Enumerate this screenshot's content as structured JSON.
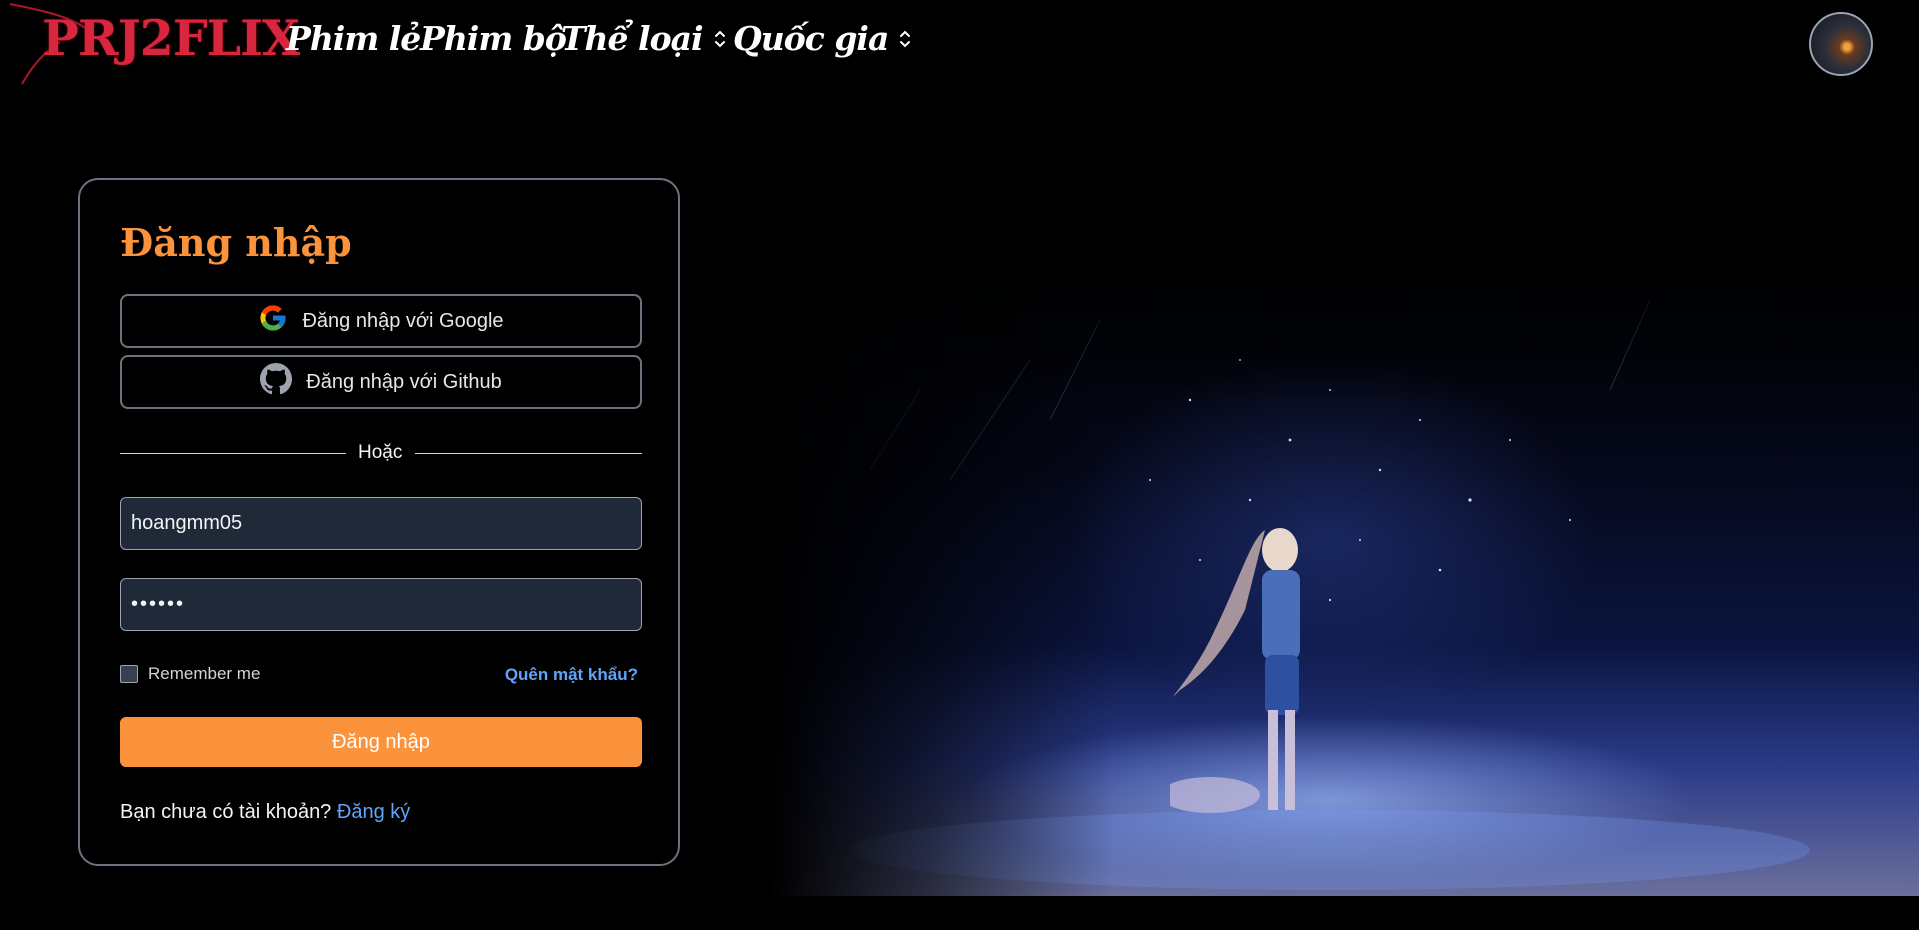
{
  "header": {
    "logo_text": "PRJ2FLIX",
    "nav": [
      {
        "label": "Phim lẻ",
        "has_dropdown": false
      },
      {
        "label": "Phim bộ",
        "has_dropdown": false
      },
      {
        "label": "Thể loại",
        "has_dropdown": true
      },
      {
        "label": "Quốc gia",
        "has_dropdown": true
      }
    ],
    "avatar_icon": "user-avatar"
  },
  "login": {
    "title": "Đăng nhập",
    "google_label": "Đăng nhập với Google",
    "github_label": "Đăng nhập với Github",
    "divider": "Hoặc",
    "username_value": "hoangmm05",
    "password_value": "••••••",
    "remember_label": "Remember me",
    "remember_checked": false,
    "forgot_label": "Quên mật khẩu?",
    "submit_label": "Đăng nhập",
    "signup_prompt": "Bạn chưa có tài khoản?",
    "signup_link": "Đăng ký"
  },
  "colors": {
    "accent": "#fb923c",
    "link": "#60a5fa",
    "logo": "#d7263d",
    "field_bg": "#1f2937",
    "border": "#6b7280"
  }
}
